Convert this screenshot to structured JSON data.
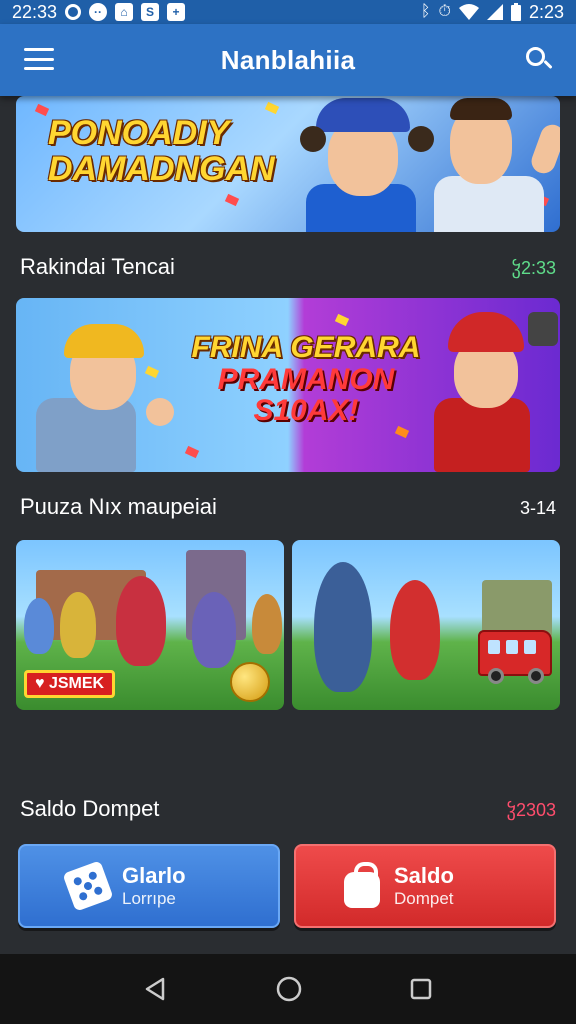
{
  "status_bar": {
    "time_left": "22:33",
    "time_right": "2:23",
    "left_icons": [
      "circle-icon",
      "dots-icon",
      "home-icon",
      "s-icon",
      "plus-icon"
    ],
    "right_icons": [
      "bluetooth-icon",
      "alarm-icon",
      "wifi-icon",
      "signal-icon",
      "battery-icon"
    ]
  },
  "app_bar": {
    "title": "Nanblahiia"
  },
  "banner_top": {
    "promo_line1": "PONOADIY",
    "promo_line2": "DAMADNGAN"
  },
  "section1": {
    "title": "Rakindai Tencai",
    "meta": "ჴ2:33",
    "meta_color": "#5fdc8a"
  },
  "banner_mid": {
    "promo_line1": "FRINA GERARA",
    "promo_line2": "PRAMANON",
    "promo_line3": "S10AX!"
  },
  "section2": {
    "title": "Puuza Nıx maupeiai",
    "meta": "3-14",
    "meta_color": "#ffffff"
  },
  "tiles": {
    "left_badge": "JSMEK"
  },
  "section3": {
    "title": "Saldo Dompet",
    "meta": "ჴ2303",
    "meta_color": "#ff4d6d"
  },
  "buttons": {
    "blue_line1": "Glarlo",
    "blue_line2": "Lorrıpe",
    "red_line1": "Saldo",
    "red_line2": "Dompet"
  },
  "colors": {
    "app_bar": "#2d72c4",
    "background": "#2a2d31",
    "accent_yellow": "#ffd631"
  }
}
